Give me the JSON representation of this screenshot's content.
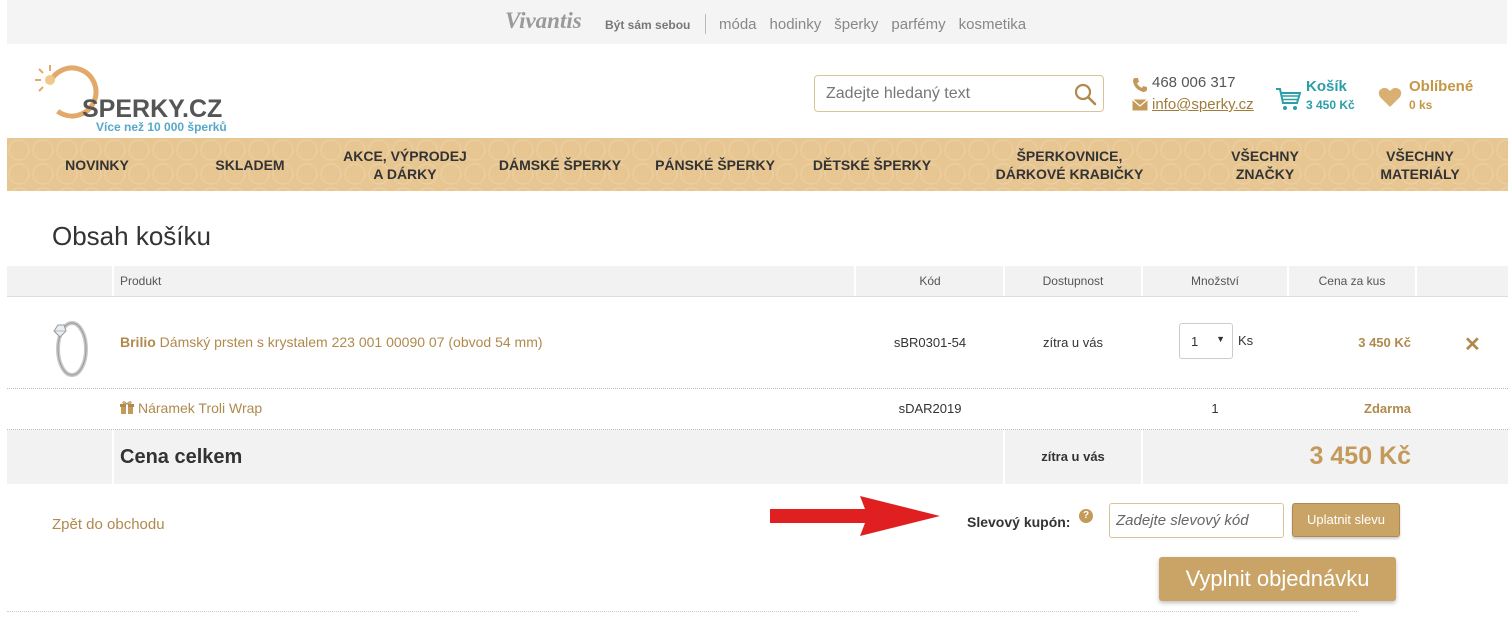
{
  "topbar": {
    "logo": "Vivantis",
    "slogan": "Být sám sebou",
    "links": [
      "móda",
      "hodinky",
      "šperky",
      "parfémy",
      "kosmetika"
    ]
  },
  "header": {
    "logo_text": "SPERKY.CZ",
    "logo_sub": "Více než 10 000 šperků",
    "search_placeholder": "Zadejte hledaný text",
    "phone": "468 006 317",
    "email": "info@sperky.cz",
    "cart_label": "Košík",
    "cart_total": "3 450 Kč",
    "fav_label": "Oblíbené",
    "fav_count": "0 ks"
  },
  "nav": [
    "NOVINKY",
    "SKLADEM",
    "AKCE, VÝPRODEJ\nA DÁRKY",
    "DÁMSKÉ ŠPERKY",
    "PÁNSKÉ ŠPERKY",
    "DĚTSKÉ ŠPERKY",
    "ŠPERKOVNICE,\nDÁRKOVÉ KRABIČKY",
    "VŠECHNY\nZNAČKY",
    "VŠECHNY\nMATERIÁLY"
  ],
  "cart": {
    "title": "Obsah košíku",
    "columns": {
      "product": "Produkt",
      "code": "Kód",
      "availability": "Dostupnost",
      "quantity": "Množství",
      "unit_price": "Cena za kus"
    },
    "items": [
      {
        "brand": "Brilio",
        "name": "Dámský prsten s krystalem 223 001 00090 07 (obvod 54 mm)",
        "code": "sBR0301-54",
        "availability": "zítra u vás",
        "quantity": "1",
        "unit": "Ks",
        "price": "3 450 Kč",
        "remove": "✕"
      },
      {
        "name": "Náramek Troli Wrap",
        "code": "sDAR2019",
        "quantity": "1",
        "price": "Zdarma"
      }
    ],
    "total_label": "Cena celkem",
    "total_availability": "zítra u vás",
    "total_price": "3 450 Kč"
  },
  "footer": {
    "back_link": "Zpět do obchodu",
    "coupon_label": "Slevový kupón:",
    "coupon_help": "?",
    "coupon_placeholder": "Zadejte slevový kód",
    "coupon_button": "Uplatnit slevu",
    "order_button": "Vyplnit objednávku"
  },
  "colors": {
    "accent_gold": "#c9a466",
    "nav_bg": "#e7c692",
    "teal": "#2b9ea7",
    "arrow_red": "#e02020"
  }
}
